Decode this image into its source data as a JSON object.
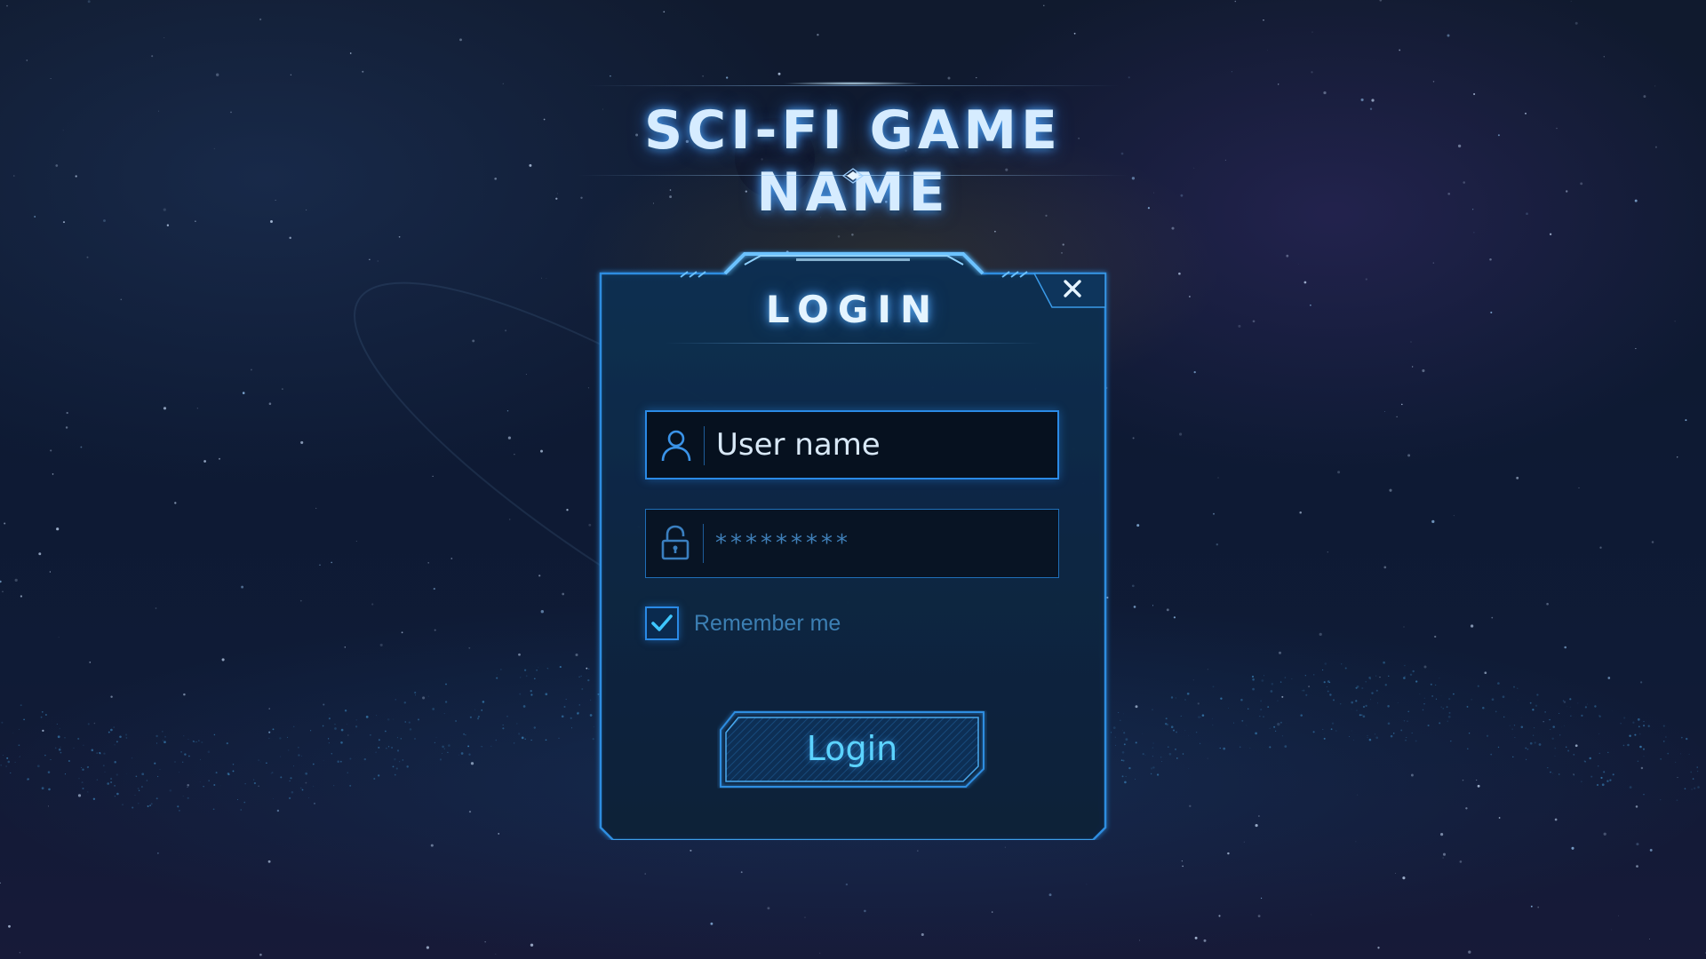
{
  "game": {
    "title": "SCI-FI GAME NAME"
  },
  "login_panel": {
    "title": "LOGIN",
    "close_icon": "close-icon",
    "username": {
      "icon": "user-icon",
      "value": "",
      "placeholder": "User name"
    },
    "password": {
      "icon": "lock-icon",
      "value": "",
      "placeholder": "*********"
    },
    "remember_me": {
      "label": "Remember me",
      "checked": true
    },
    "login_button": {
      "label": "Login"
    }
  },
  "colors": {
    "accent": "#2a8ae6",
    "title_glow": "#50aaff",
    "panel_bg": "#0c2540",
    "button_text": "#5cd3ff"
  }
}
